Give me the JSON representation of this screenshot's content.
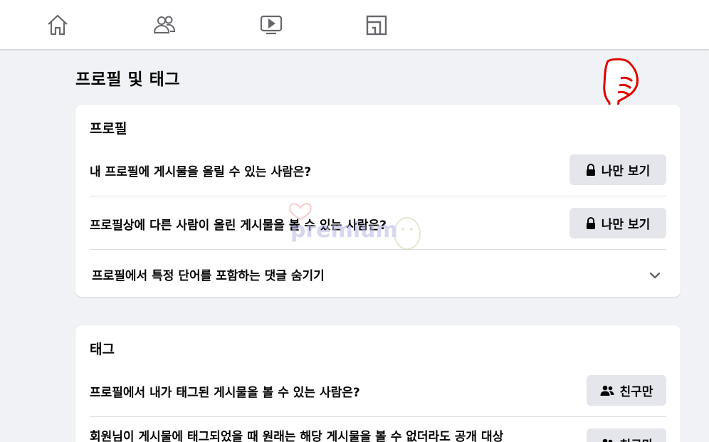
{
  "nav": {
    "items": [
      {
        "icon": "home-icon"
      },
      {
        "icon": "friends-icon"
      },
      {
        "icon": "watch-icon"
      },
      {
        "icon": "marketplace-icon"
      }
    ]
  },
  "page": {
    "title": "프로필 및 태그"
  },
  "profile_card": {
    "title": "프로필",
    "rows": [
      {
        "label": "내 프로필에 게시물을 올릴 수 있는 사람은?",
        "button": "나만 보기",
        "icon": "lock-icon"
      },
      {
        "label": "프로필상에 다른 사람이 올린 게시물을 볼 수 있는 사람은?",
        "button": "나만 보기",
        "icon": "lock-icon"
      },
      {
        "label": "프로필에서 특정 단어를 포함하는 댓글 숨기기",
        "icon": "chevron-down-icon"
      }
    ]
  },
  "tag_card": {
    "title": "태그",
    "rows": [
      {
        "label": "프로필에서 내가 태그된 게시물을 볼 수 있는 사람은?",
        "button": "친구만",
        "icon": "friends-icon"
      },
      {
        "label": "회원님이 게시물에 태그되었을 때 원래는 해당 게시물을 볼 수 없더라도 공개 대상",
        "button": "친구만",
        "icon": "friends-icon"
      }
    ]
  },
  "watermark": {
    "text": "premium"
  },
  "colors": {
    "background": "#f0f2f5",
    "card": "#ffffff",
    "button": "#e4e6eb",
    "pointer": "#e00000"
  }
}
